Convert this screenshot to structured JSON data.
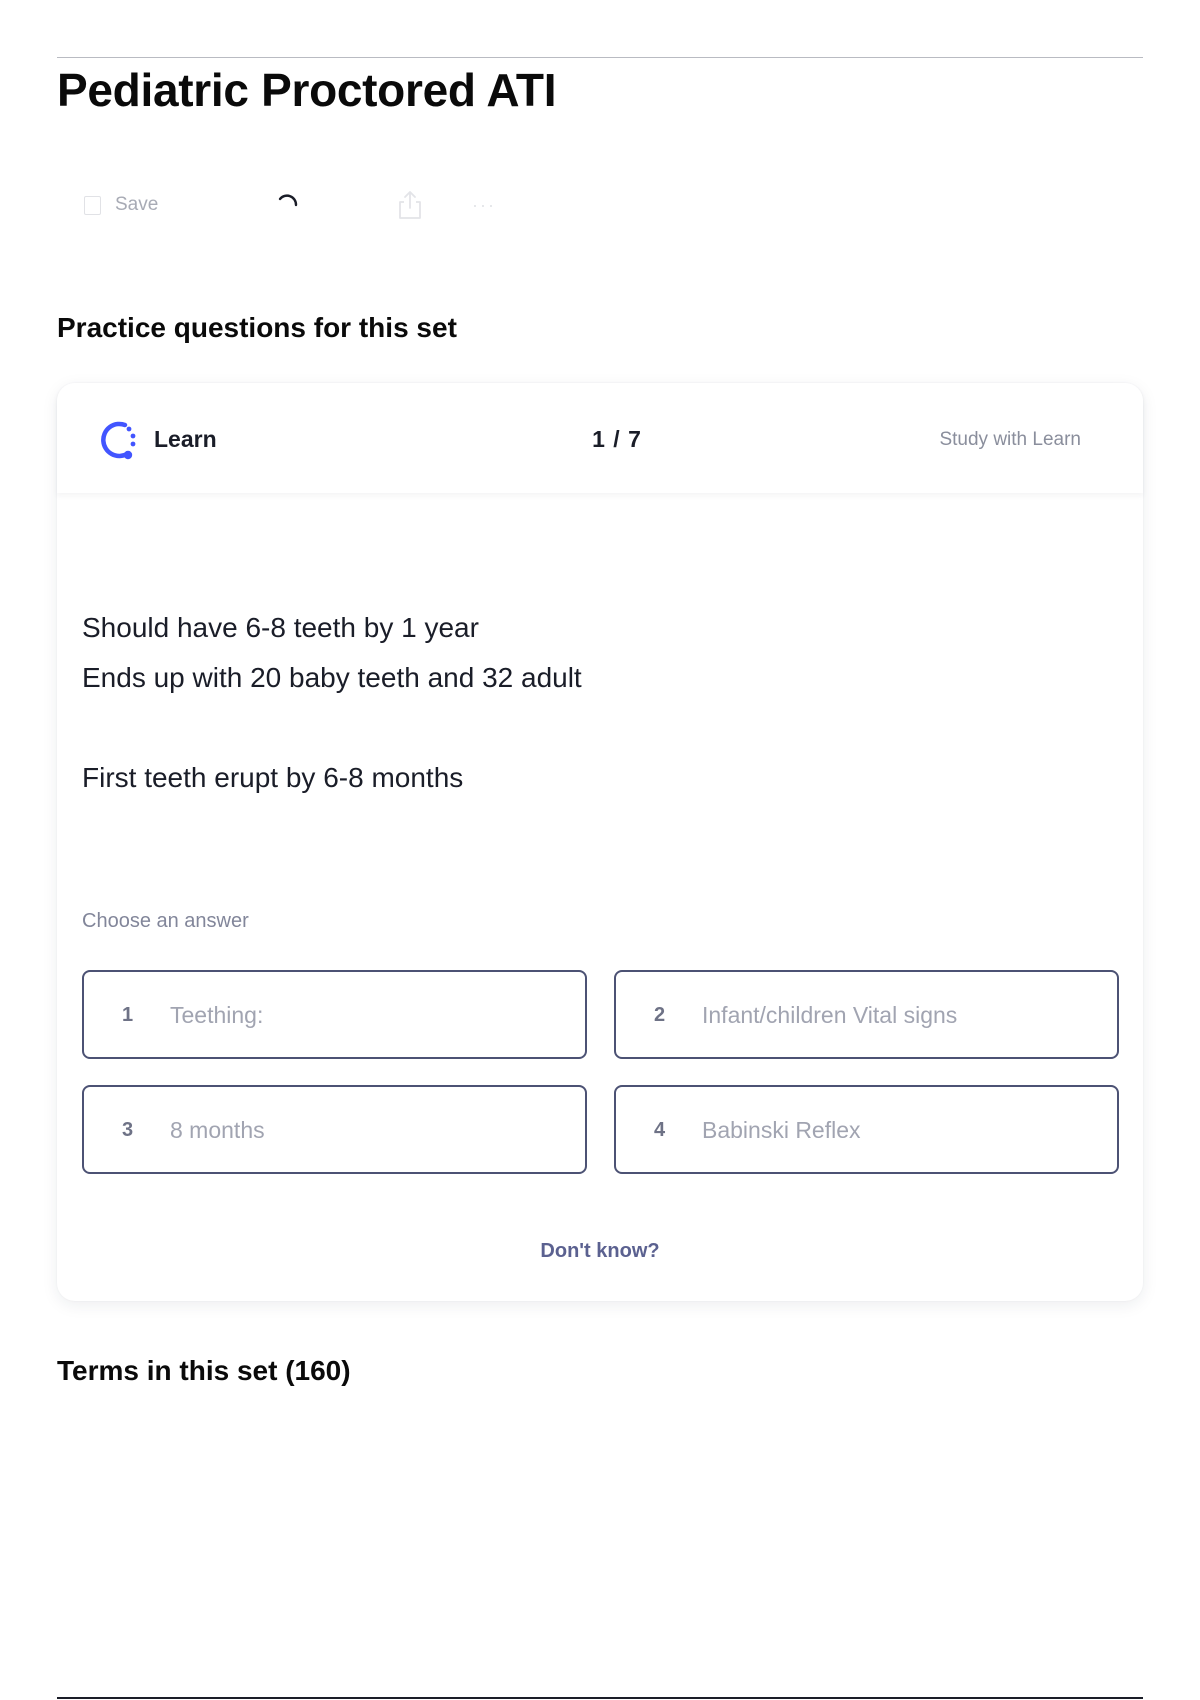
{
  "page": {
    "title": "Pediatric Proctored ATI"
  },
  "toolbar": {
    "save_label": "Save",
    "more_label": "···",
    "icons": [
      "bookmark-icon",
      "loading-spinner-icon",
      "share-icon",
      "more-icon"
    ]
  },
  "practice": {
    "section_title": "Practice questions for this set",
    "card": {
      "mode_label": "Learn",
      "progress": "1 / 7",
      "study_link": "Study with Learn",
      "question_lines": [
        "Should have 6-8 teeth by 1 year",
        "Ends up with 20 baby teeth and 32 adult",
        "First teeth erupt by 6-8 months"
      ],
      "choose_label": "Choose an answer",
      "options": [
        {
          "number": "1",
          "text": "Teething:"
        },
        {
          "number": "2",
          "text": "Infant/children Vital signs"
        },
        {
          "number": "3",
          "text": "8 months"
        },
        {
          "number": "4",
          "text": "Babinski Reflex"
        }
      ],
      "dont_know_label": "Don't know?"
    }
  },
  "terms": {
    "section_title": "Terms in this set (160)"
  },
  "colors": {
    "accent": "#4255ff",
    "option_border": "#4c5274",
    "muted_text": "#a1a4b1",
    "link_text": "#5b6190"
  }
}
